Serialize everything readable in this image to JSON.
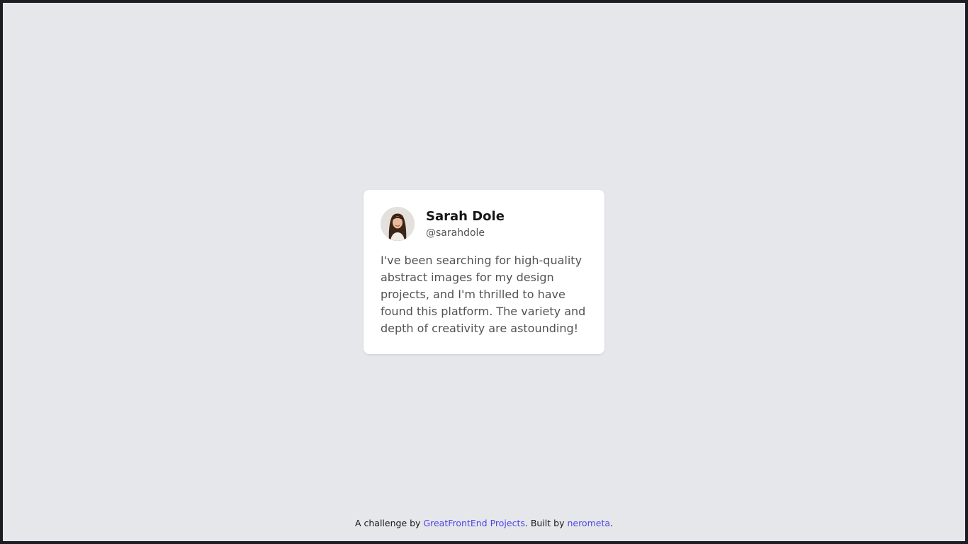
{
  "testimonial": {
    "name": "Sarah Dole",
    "handle": "@sarahdole",
    "text": "I've been searching for high-quality abstract images for my design projects, and I'm thrilled to have found this platform. The variety and depth of creativity are astounding!"
  },
  "footer": {
    "prefix": "A challenge by ",
    "challenge_link": "GreatFrontEnd Projects",
    "middle": ". Built by ",
    "author_link": "nerometa",
    "suffix": "."
  },
  "colors": {
    "background": "#e5e7eb",
    "card": "#ffffff",
    "link": "#4f46e5"
  }
}
